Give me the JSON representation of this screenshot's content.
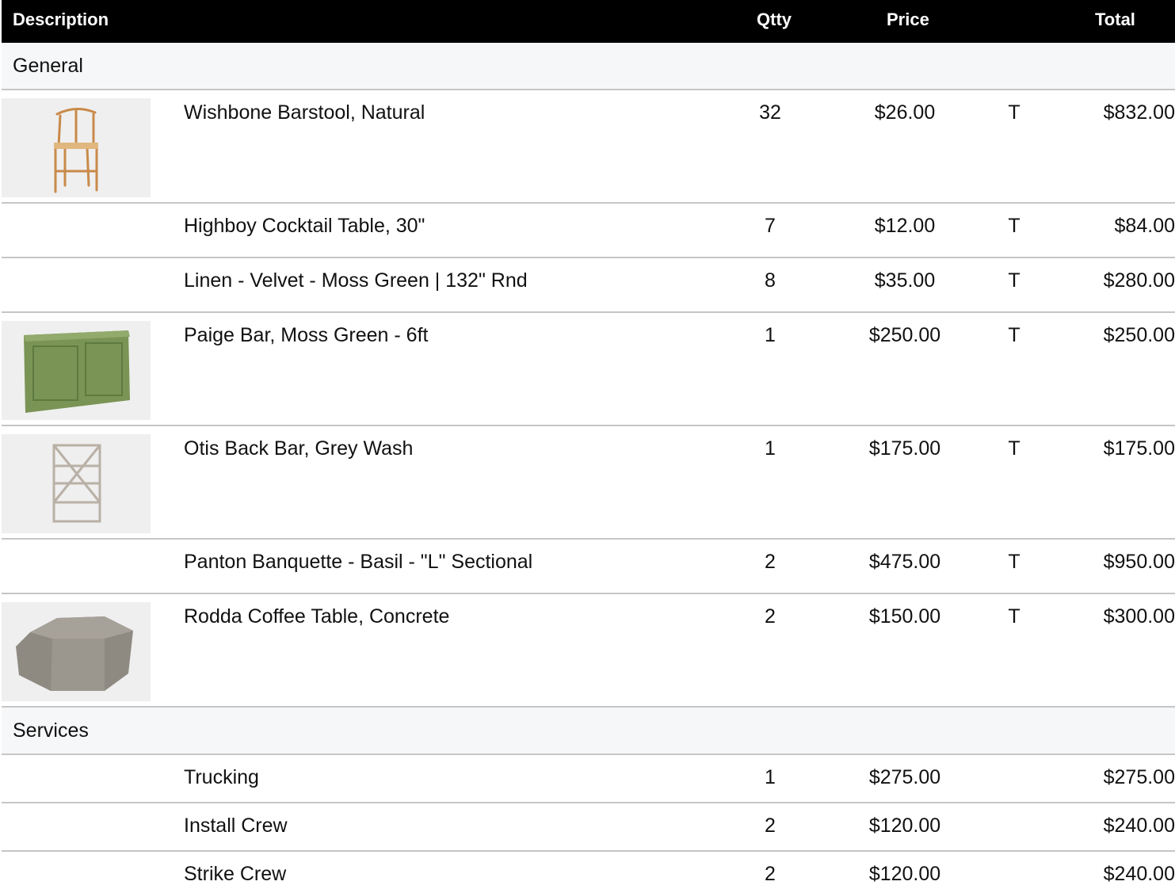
{
  "header": {
    "description": "Description",
    "qty": "Qtty",
    "price": "Price",
    "total": "Total"
  },
  "sections": [
    {
      "name": "General",
      "rows": [
        {
          "description": "Wishbone Barstool, Natural",
          "qty": "32",
          "price": "$26.00",
          "tax": "T",
          "total": "$832.00",
          "image": "barstool-image"
        },
        {
          "description": "Highboy Cocktail Table, 30\"",
          "qty": "7",
          "price": "$12.00",
          "tax": "T",
          "total": "$84.00",
          "image": ""
        },
        {
          "description": "Linen - Velvet - Moss Green | 132\" Rnd",
          "qty": "8",
          "price": "$35.00",
          "tax": "T",
          "total": "$280.00",
          "image": ""
        },
        {
          "description": "Paige Bar, Moss Green - 6ft",
          "qty": "1",
          "price": "$250.00",
          "tax": "T",
          "total": "$250.00",
          "image": "green-bar-image"
        },
        {
          "description": "Otis Back Bar, Grey Wash",
          "qty": "1",
          "price": "$175.00",
          "tax": "T",
          "total": "$175.00",
          "image": "back-bar-shelf-image"
        },
        {
          "description": "Panton Banquette - Basil - \"L\" Sectional",
          "qty": "2",
          "price": "$475.00",
          "tax": "T",
          "total": "$950.00",
          "image": ""
        },
        {
          "description": "Rodda Coffee Table, Concrete",
          "qty": "2",
          "price": "$150.00",
          "tax": "T",
          "total": "$300.00",
          "image": "concrete-table-image"
        }
      ]
    },
    {
      "name": "Services",
      "rows": [
        {
          "description": "Trucking",
          "qty": "1",
          "price": "$275.00",
          "tax": "",
          "total": "$275.00",
          "image": ""
        },
        {
          "description": "Install Crew",
          "qty": "2",
          "price": "$120.00",
          "tax": "",
          "total": "$240.00",
          "image": ""
        },
        {
          "description": "Strike Crew",
          "qty": "2",
          "price": "$120.00",
          "tax": "",
          "total": "$240.00",
          "image": ""
        }
      ]
    }
  ]
}
